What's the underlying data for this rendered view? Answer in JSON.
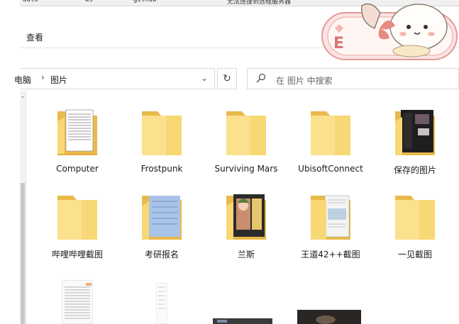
{
  "top_strip": [
    "auto",
    "ws",
    "github",
    "无法连接到远程服务器"
  ],
  "ribbon": {
    "tab_view": "查看"
  },
  "address": {
    "crumbs": [
      "电脑",
      "图片"
    ]
  },
  "search": {
    "placeholder": "在 图片 中搜索"
  },
  "items": [
    {
      "label": "Computer",
      "thumb": "doc"
    },
    {
      "label": "Frostpunk",
      "thumb": "none"
    },
    {
      "label": "Surviving Mars",
      "thumb": "none"
    },
    {
      "label": "UbisoftConnect",
      "thumb": "none"
    },
    {
      "label": "保存的图片",
      "thumb": "dark"
    },
    {
      "label": "哔哩哔哩截图",
      "thumb": "none"
    },
    {
      "label": "考研报名",
      "thumb": "blue"
    },
    {
      "label": "兰斯",
      "thumb": "anime"
    },
    {
      "label": "王道42++截图",
      "thumb": "paper"
    },
    {
      "label": "一见截图",
      "thumb": "none"
    }
  ],
  "colors": {
    "folder": "#f8d775",
    "folder_back": "#e9b949",
    "accent": "#0078d7"
  }
}
